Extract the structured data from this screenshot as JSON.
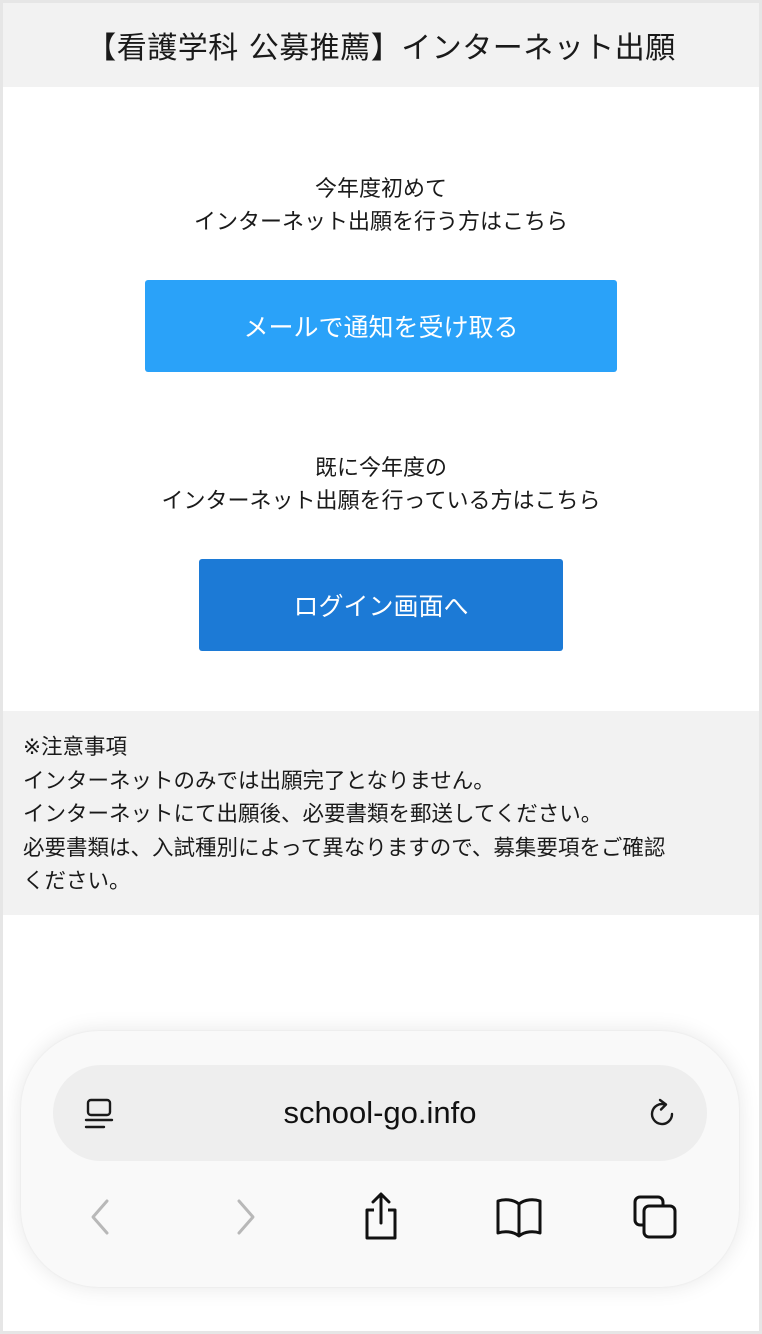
{
  "header": {
    "title": "【看護学科 公募推薦】インターネット出願"
  },
  "new_applicant": {
    "line1": "今年度初めて",
    "line2": "インターネット出願を行う方はこちら",
    "button_label": "メールで通知を受け取る"
  },
  "existing_applicant": {
    "line1": "既に今年度の",
    "line2": "インターネット出願を行っている方はこちら",
    "button_label": "ログイン画面へ"
  },
  "notice": {
    "lines": [
      "※注意事項",
      "インターネットのみでは出願完了となりません。",
      "インターネットにて出願後、必要書類を郵送してください。",
      "必要書類は、入試種別によって異なりますので、募集要項をご確認",
      "ください。"
    ]
  },
  "browser": {
    "url": "school-go.info",
    "icons": {
      "reader": "reader-icon",
      "reload": "reload-icon",
      "back": "back-icon",
      "forward": "forward-icon",
      "share": "share-icon",
      "bookmarks": "bookmarks-icon",
      "tabs": "tabs-icon"
    }
  },
  "colors": {
    "mail_button": "#2aa2f9",
    "login_button": "#1c7ad6",
    "header_bg": "#f2f2f2",
    "notice_bg": "#f2f2f2",
    "disabled_icon": "#b8b8b8"
  }
}
